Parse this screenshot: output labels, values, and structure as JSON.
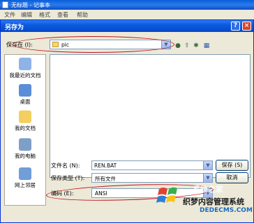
{
  "notepad": {
    "title": "无标题 - 记事本",
    "menu": [
      "文件",
      "编辑",
      "格式",
      "查看",
      "帮助"
    ]
  },
  "dialog": {
    "title": "另存为",
    "help_glyph": "?",
    "close_glyph": "×",
    "save_in_label": "保存在 (I):",
    "save_in_value": "pic",
    "places": [
      "我最近的文档",
      "桌面",
      "我的文档",
      "我的电脑",
      "网上邻居"
    ],
    "filename_label": "文件名 (N):",
    "filename_value": "REN.BAT",
    "filetype_label": "保存类型 (T):",
    "filetype_value": "所有文件",
    "encoding_label": "编码 (E):",
    "encoding_value": "ANSI",
    "save_button": "保存 (S)",
    "cancel_button": "取消",
    "dropdown_arrow": "▼"
  },
  "watermark": {
    "text_cn": "织梦内容管理系统",
    "text_en": "DEDECMS.COM",
    "ghost": "系统之家"
  },
  "colors": {
    "title_bar": "#0a5be0",
    "annotation": "#c0121c",
    "dialog_bg": "#ece9d8"
  }
}
